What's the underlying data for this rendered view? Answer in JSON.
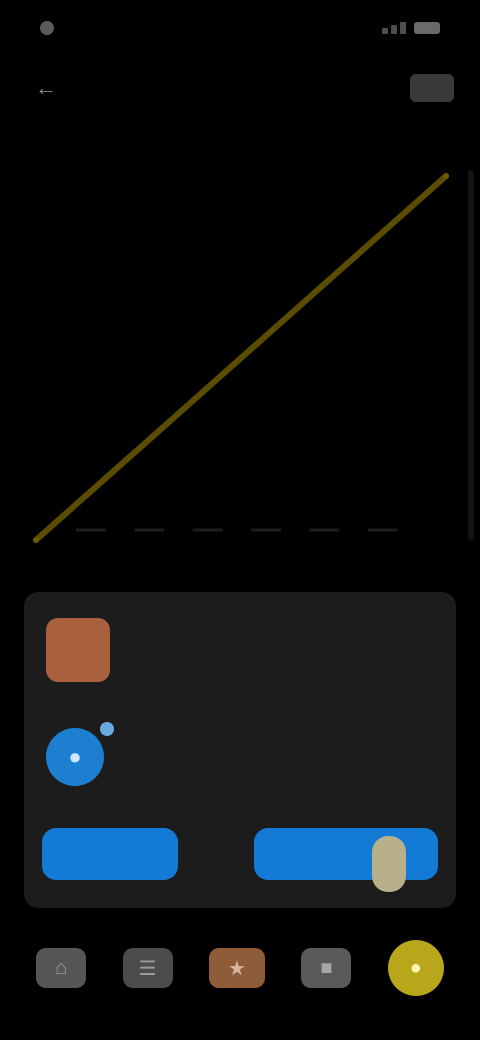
{
  "status_bar": {
    "time": "",
    "signal_level": 3
  },
  "top_bar": {
    "title": ""
  },
  "subtitle": "",
  "chart_data": {
    "type": "line",
    "title": "",
    "xlabel": "",
    "ylabel": "",
    "xlim": [
      0,
      100
    ],
    "ylim": [
      0,
      100
    ],
    "grid": false,
    "series": [
      {
        "x": [
          0,
          100
        ],
        "values": [
          0,
          100
        ],
        "color": "#6b5a00"
      }
    ],
    "baseline_dashes": 6
  },
  "card": {
    "title": "",
    "subtitle": "",
    "left_button_label": "",
    "right_button_label": ""
  },
  "nav": {
    "items": [
      {
        "icon": "home-icon"
      },
      {
        "icon": "list-icon"
      },
      {
        "icon": "star-icon"
      },
      {
        "icon": "chat-icon"
      },
      {
        "icon": "profile-icon"
      }
    ]
  },
  "colors": {
    "accent_blue": "#137ad6",
    "chart_line": "#6b5a00",
    "avatar": "#a8613c",
    "nav_highlight": "#b9a71b"
  }
}
